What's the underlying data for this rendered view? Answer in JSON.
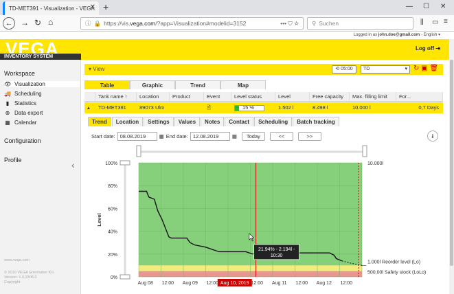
{
  "browser": {
    "tab_title": "TD-MET391 - Visualization - VEGA",
    "url_prefix": "https://vis.",
    "url_domain": "vega.com",
    "url_suffix": "/?app=Visualization#modelid=3152",
    "url_dots": "•••",
    "search_placeholder": "Suchen"
  },
  "header": {
    "login_prefix": "Logged in as",
    "login_user": "john.doe@gmail.com",
    "language": "English",
    "logo": "VEGA",
    "logo_sub": "INVENTORY SYSTEM",
    "logoff": "Log off"
  },
  "sidebar": {
    "workspace": "Workspace",
    "items": [
      {
        "label": "Visualization",
        "icon": "eye-icon"
      },
      {
        "label": "Scheduling",
        "icon": "truck-icon"
      },
      {
        "label": "Statistics",
        "icon": "bar-chart-icon"
      },
      {
        "label": "Data export",
        "icon": "download-icon"
      },
      {
        "label": "Calendar",
        "icon": "calendar-icon"
      }
    ],
    "configuration": "Configuration",
    "profile": "Profile",
    "footer_url": "www.vega.com",
    "footer_copy": "© 2019 VEGA Grieshaber KG",
    "footer_version": "Version: 1.0.2308.0",
    "footer_copyright": "Copyright"
  },
  "viewbar": {
    "label": "View",
    "time": "05:00",
    "tank_select": "TD"
  },
  "main_tabs": [
    "Table",
    "Graphic",
    "Trend",
    "Map"
  ],
  "table": {
    "headers": [
      "Tank name ↑",
      "Location",
      "Product",
      "Event",
      "Level status",
      "Level",
      "Free capacity",
      "Max. filling limit",
      "For..."
    ],
    "row": {
      "tank": "TD-MET391",
      "location": "89073 Ulm",
      "product": "",
      "level_status": "15 %",
      "level": "1.502 l",
      "free": "8.498 l",
      "max": "10.000 l",
      "forecast": "0,7 Days"
    }
  },
  "sub_tabs": [
    "Trend",
    "Location",
    "Settings",
    "Values",
    "Notes",
    "Contact",
    "Scheduling",
    "Batch tracking"
  ],
  "dates": {
    "start_label": "Start date:",
    "start": "08.08.2019",
    "end_label": "End date:",
    "end": "12.08.2019",
    "today": "Today",
    "prev": "<<",
    "next": ">>"
  },
  "chart_data": {
    "type": "line",
    "ylabel": "Level",
    "yticks": [
      "100%",
      "80%",
      "60%",
      "40%",
      "20%",
      "0%"
    ],
    "xticks": [
      "Aug 08",
      "12:00",
      "Aug 09",
      "12:00",
      "Aug 10, 2019",
      "12:00",
      "Aug 11",
      "12:00",
      "Aug 12",
      "12:00"
    ],
    "ylim": [
      0,
      100
    ],
    "xlim": [
      0,
      10
    ],
    "grid": true,
    "max_label": "10.000l",
    "reorder_label": "1.000l Reorder level (Lo)",
    "safety_label": "500,00l Safety stock (LoLo)",
    "reorder_level": 10,
    "safety_level": 5,
    "tooltip": "21.94% - 2.194l - 10:30",
    "series": [
      {
        "points": [
          [
            0,
            75
          ],
          [
            0.35,
            75
          ],
          [
            0.45,
            70
          ],
          [
            0.7,
            68
          ],
          [
            0.85,
            58
          ],
          [
            1.05,
            50
          ],
          [
            1.25,
            40
          ],
          [
            1.35,
            35
          ],
          [
            1.45,
            34
          ],
          [
            2.15,
            34
          ],
          [
            2.3,
            30
          ],
          [
            2.5,
            28
          ],
          [
            3,
            26
          ],
          [
            3.3,
            24
          ],
          [
            3.6,
            22
          ],
          [
            4.8,
            22
          ],
          [
            5.1,
            20
          ],
          [
            5.25,
            21
          ],
          [
            8.55,
            21
          ],
          [
            8.75,
            19
          ],
          [
            8.85,
            16
          ],
          [
            9.1,
            14
          ]
        ],
        "forecast": [
          [
            9.1,
            14
          ],
          [
            9.5,
            12
          ],
          [
            10,
            10
          ]
        ]
      }
    ],
    "current_x": 5.25,
    "forecast_x": 9.85,
    "colors": {
      "green": "#86cf7b",
      "yellow": "#f3ec7b",
      "red": "#e99594",
      "line": "#111",
      "marker": "#c00"
    }
  }
}
